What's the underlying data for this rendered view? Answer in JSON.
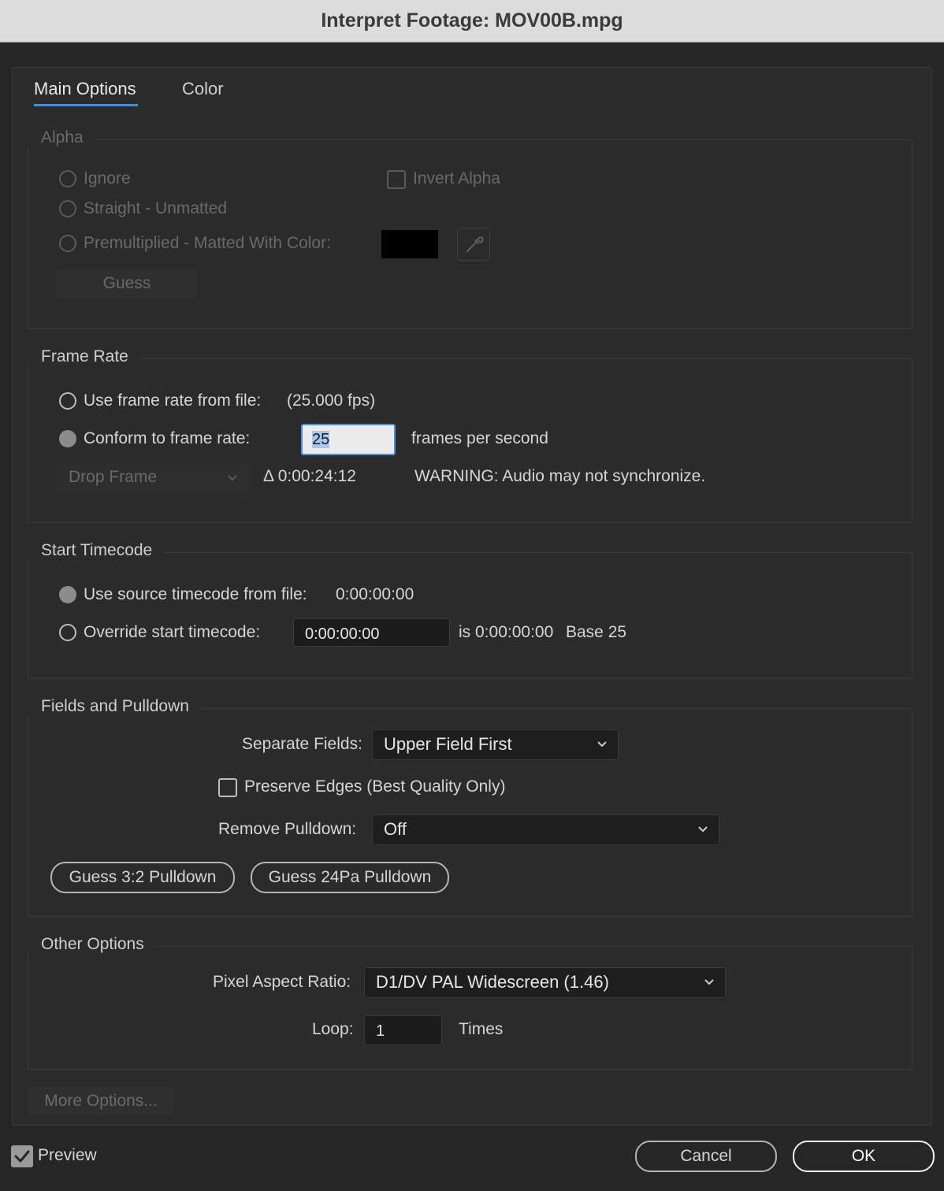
{
  "window": {
    "title": "Interpret Footage: MOV00B.mpg"
  },
  "tabs": [
    {
      "label": "Main Options"
    },
    {
      "label": "Color"
    }
  ],
  "alpha": {
    "title": "Alpha",
    "ignore": "Ignore",
    "straight": "Straight - Unmatted",
    "premultiplied": "Premultiplied - Matted With Color:",
    "invert": "Invert Alpha",
    "guess": "Guess",
    "matte_color": "#000000"
  },
  "frame_rate": {
    "title": "Frame Rate",
    "use_file": "Use frame rate from file:",
    "file_fps": "(25.000 fps)",
    "conform": "Conform to frame rate:",
    "conform_value": "25",
    "fps_unit": "frames per second",
    "drop_frame": "Drop Frame",
    "delta": "Δ 0:00:24:12",
    "warning": "WARNING: Audio may not synchronize."
  },
  "start_timecode": {
    "title": "Start Timecode",
    "use_source": "Use source timecode from file:",
    "source_value": "0:00:00:00",
    "override": "Override start timecode:",
    "override_value": "0:00:00:00",
    "is_value": "is 0:00:00:00",
    "base": "Base 25"
  },
  "fields": {
    "title": "Fields and Pulldown",
    "separate_label": "Separate Fields:",
    "separate_value": "Upper Field First",
    "preserve": "Preserve Edges (Best Quality Only)",
    "remove_label": "Remove Pulldown:",
    "remove_value": "Off",
    "guess32": "Guess 3:2 Pulldown",
    "guess24": "Guess 24Pa Pulldown"
  },
  "other": {
    "title": "Other Options",
    "par_label": "Pixel Aspect Ratio:",
    "par_value": "D1/DV PAL Widescreen (1.46)",
    "loop_label": "Loop:",
    "loop_value": "1",
    "times": "Times"
  },
  "more_options": "More Options...",
  "footer": {
    "preview": "Preview",
    "cancel": "Cancel",
    "ok": "OK"
  }
}
